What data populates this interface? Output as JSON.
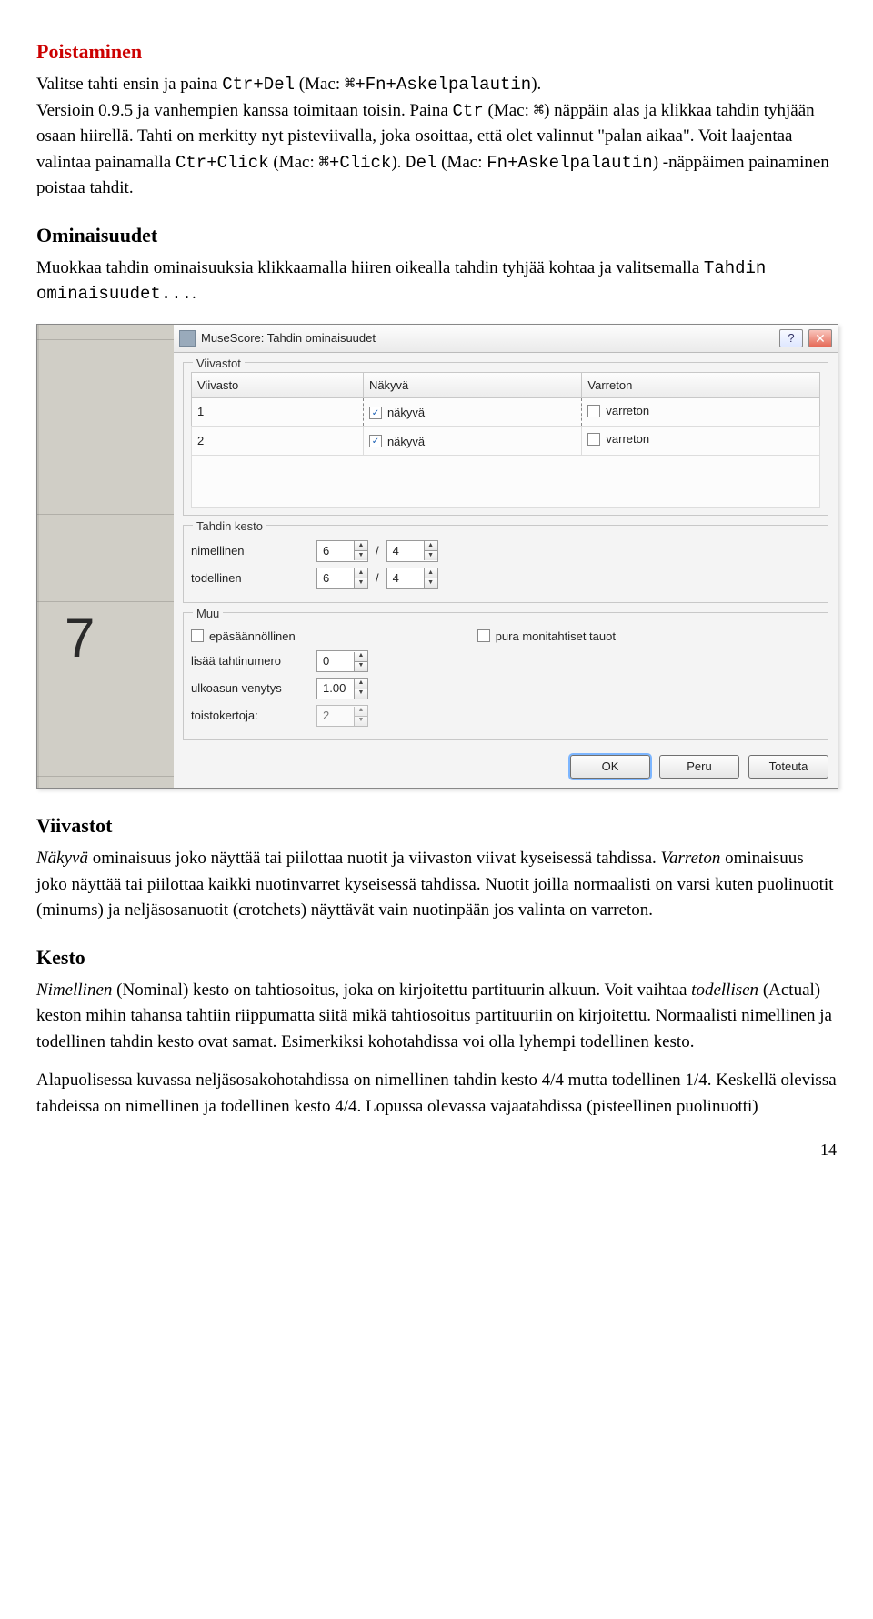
{
  "headings": {
    "poistaminen": "Poistaminen",
    "ominaisuudet": "Ominaisuudet",
    "viivastot": "Viivastot",
    "kesto": "Kesto"
  },
  "p_delete_1_parts": {
    "a": "Valitse tahti ensin ja paina ",
    "b": "Ctr+Del",
    "c": " (Mac: ",
    "d": "⌘+Fn+Askelpalautin",
    "e": ").",
    "f": "Versioin 0.9.5 ja vanhempien kanssa toimitaan toisin. Paina ",
    "g": "Ctr",
    "h": " (Mac: ",
    "i": "⌘",
    "j": ") näppäin alas ja klikkaa tahdin tyhjään osaan hiirellä. Tahti on merkitty nyt pisteviivalla, joka osoittaa, että olet valinnut \"palan aikaa\". Voit laajentaa valintaa painamalla ",
    "k": "Ctr+Click",
    "l": " (Mac: ",
    "m": "⌘+Click",
    "n": "). ",
    "o": "Del",
    "p": " (Mac: ",
    "q": "Fn+Askelpalautin",
    "r": ") -näppäimen painaminen poistaa tahdit."
  },
  "p_props_parts": {
    "a": "Muokkaa tahdin ominaisuuksia klikkaamalla hiiren oikealla tahdin tyhjää kohtaa ja valitsemalla ",
    "b": "Tahdin ominaisuudet...",
    "c": "."
  },
  "dialog": {
    "title": "MuseScore: Tahdin ominaisuudet",
    "help": "?",
    "close": "✕",
    "group_staves": "Viivastot",
    "col_staff": "Viivasto",
    "col_visible": "Näkyvä",
    "col_stemless": "Varreton",
    "rows": [
      {
        "n": "1",
        "visible": true,
        "vlabel": "näkyvä",
        "stemless": false,
        "slabel": "varreton"
      },
      {
        "n": "2",
        "visible": true,
        "vlabel": "näkyvä",
        "stemless": false,
        "slabel": "varreton"
      }
    ],
    "group_dur": "Tahdin kesto",
    "nominal_label": "nimellinen",
    "actual_label": "todellinen",
    "nominal_num": "6",
    "nominal_den": "4",
    "actual_num": "6",
    "actual_den": "4",
    "slash": "/",
    "group_other": "Muu",
    "irregular": "epäsäännöllinen",
    "break_rests": "pura monitahtiset tauot",
    "add_barno": "lisää tahtinumero",
    "add_barno_val": "0",
    "layout_stretch": "ulkoasun venytys",
    "layout_stretch_val": "1.00",
    "repeat_count": "toistokertoja:",
    "repeat_count_val": "2",
    "ok": "OK",
    "cancel": "Peru",
    "apply": "Toteuta"
  },
  "p_viivastot_parts": {
    "a": "Näkyvä",
    "b": " ominaisuus joko näyttää tai piilottaa nuotit ja viivaston viivat kyseisessä tahdissa. ",
    "c": "Varreton",
    "d": " ominaisuus joko näyttää tai piilottaa kaikki nuotinvarret kyseisessä tahdissa. Nuotit joilla normaalisti on varsi kuten puolinuotit (minums) ja neljäsosanuotit (crotchets) näyttävät vain nuotinpään jos valinta on varreton."
  },
  "p_kesto_parts": {
    "a": "Nimellinen",
    "b": " (Nominal) kesto on tahtiosoitus, joka on kirjoitettu partituurin alkuun. Voit vaihtaa ",
    "c": "todellisen",
    "d": " (Actual) keston mihin tahansa tahtiin riippumatta siitä mikä tahtiosoitus partituuriin on kirjoitettu. Normaalisti nimellinen ja todellinen tahdin kesto ovat samat. Esimerkiksi kohotahdissa voi olla lyhempi todellinen kesto."
  },
  "p_bottom": "Alapuolisessa kuvassa neljäsosakohotahdissa on nimellinen tahdin kesto 4/4 mutta todellinen 1/4. Keskellä olevissa tahdeissa on nimellinen ja todellinen kesto 4/4. Lopussa olevassa vajaatahdissa (pisteellinen puolinuotti)",
  "page_num": "14"
}
